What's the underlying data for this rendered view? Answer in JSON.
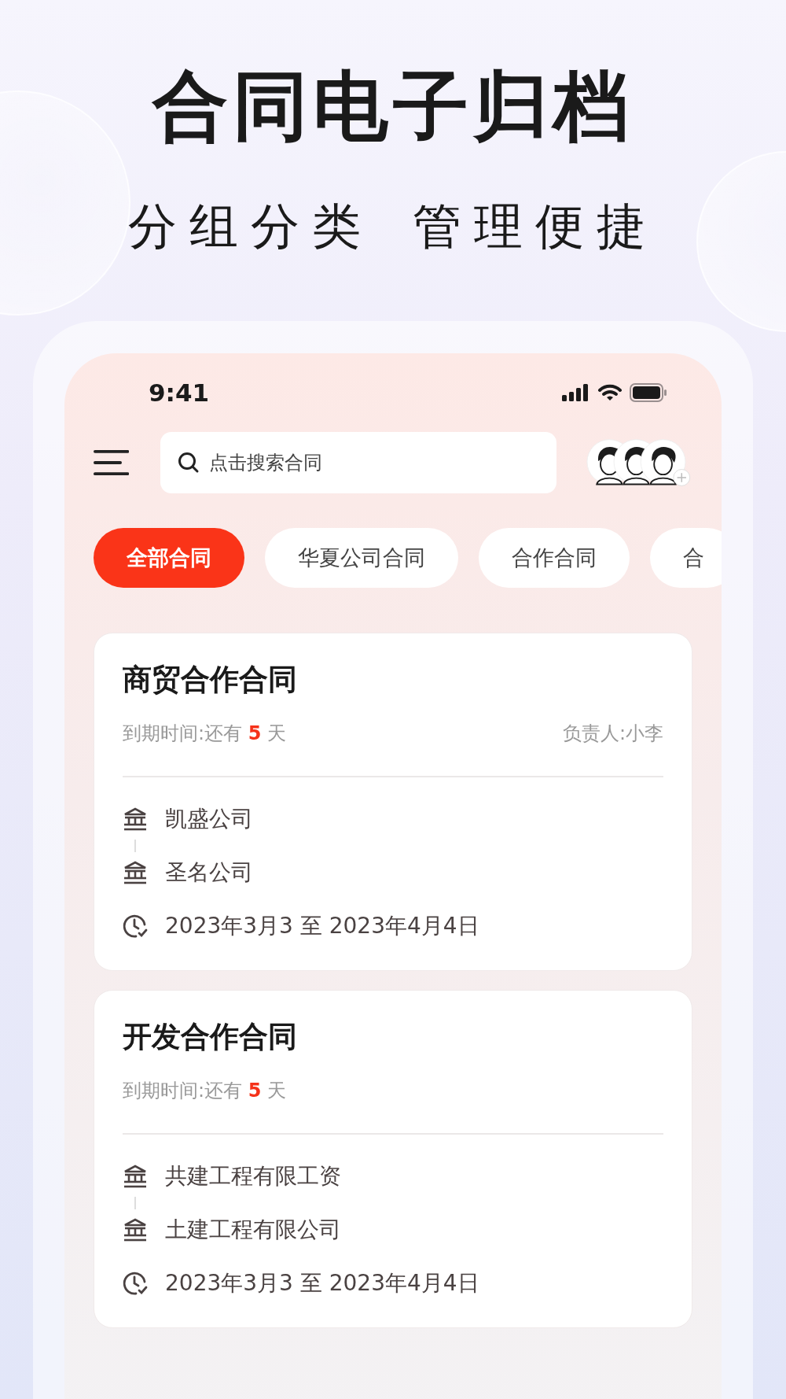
{
  "headline": "合同电子归档",
  "subtitle": [
    "分组分类",
    "管理便捷"
  ],
  "status_bar": {
    "time": "9:41"
  },
  "search": {
    "placeholder": "点击搜索合同"
  },
  "avatars": [
    {
      "kind": "member"
    },
    {
      "kind": "member"
    },
    {
      "kind": "member"
    }
  ],
  "tabs": [
    {
      "label": "全部合同",
      "selected": true
    },
    {
      "label": "华夏公司合同",
      "selected": false
    },
    {
      "label": "合作合同",
      "selected": false
    },
    {
      "label": "合",
      "selected": false
    }
  ],
  "contracts": [
    {
      "title": "商贸合作合同",
      "due_prefix": "到期时间:还有",
      "due_days": "5",
      "due_suffix": "天",
      "owner": "负责人:小李",
      "parties": [
        "凯盛公司",
        "圣名公司"
      ],
      "period": "2023年3月3 至 2023年4月4日"
    },
    {
      "title": "开发合作合同",
      "due_prefix": "到期时间:还有",
      "due_days": "5",
      "due_suffix": "天",
      "parties": [
        "共建工程有限工资",
        "土建工程有限公司"
      ],
      "period": "2023年3月3 至 2023年4月4日"
    }
  ]
}
